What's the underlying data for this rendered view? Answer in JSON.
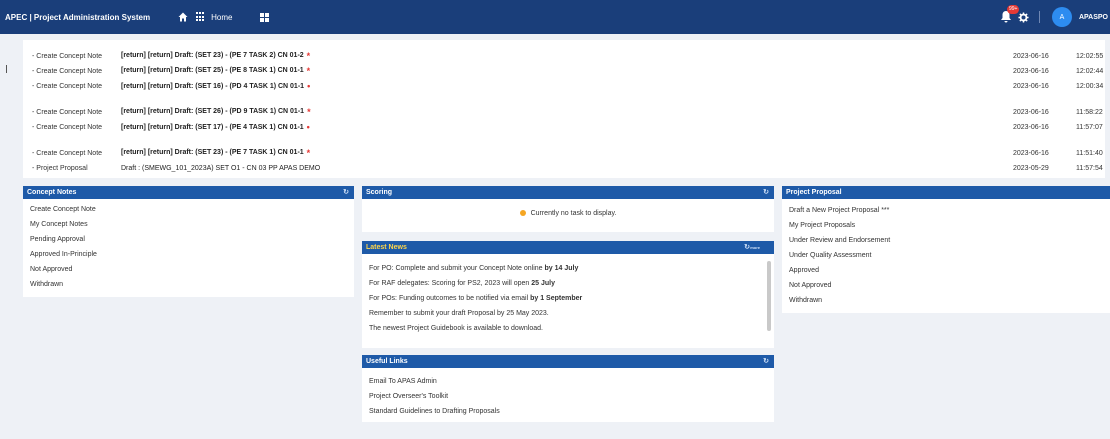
{
  "topbar": {
    "title": "APEC | Project Administration System",
    "home_label": "Home",
    "badge": "99+",
    "avatar_initial": "A",
    "username": "APASPO"
  },
  "activity": [
    {
      "type": "- Create Concept Note",
      "desc": "[return] [return]  Draft:  (SET 23) - (PE 7 TASK 2) CN 01-2",
      "date": "2023-06-16",
      "time": "12:02:55"
    },
    {
      "type": "- Create Concept Note",
      "desc": "[return] [return]  Draft:  (SET 25) - (PE 8 TASK 1) CN 01-1",
      "date": "2023-06-16",
      "time": "12:02:44"
    },
    {
      "type": "- Create Concept Note",
      "desc": "[return] [return]  Draft:  (SET 16) - (PD 4 TASK 1) CN 01-1",
      "date": "2023-06-16",
      "time": "12:00:34"
    },
    {
      "type": "- Create Concept Note",
      "desc": "[return] [return]  Draft:  (SET 26) - (PD 9 TASK 1) CN 01-1",
      "date": "2023-06-16",
      "time": "11:58:22"
    },
    {
      "type": "- Create Concept Note",
      "desc": "[return] [return]  Draft:  (SET 17) - (PE 4 TASK 1) CN 01-1",
      "date": "2023-06-16",
      "time": "11:57:07"
    },
    {
      "type": "- Create Concept Note",
      "desc": "[return] [return]  Draft:  (SET 23) - (PE 7 TASK 1) CN 01-1",
      "date": "2023-06-16",
      "time": "11:51:40"
    },
    {
      "type": "- Project Proposal",
      "desc": "Draft : (SMEWG_101_2023A) SET O1 - CN 03 PP APAS DEMO",
      "date": "2023-05-29",
      "time": "11:57:54"
    }
  ],
  "concept_notes": {
    "title": "Concept Notes",
    "items": [
      "Create Concept Note",
      "My Concept Notes",
      "Pending Approval",
      "Approved In-Principle",
      "Not Approved",
      "Withdrawn"
    ]
  },
  "scoring": {
    "title": "Scoring",
    "empty": "Currently no task to display."
  },
  "news": {
    "title": "Latest News",
    "more": "more",
    "items": [
      {
        "text": "For PO: Complete and submit your Concept Note online ",
        "bold": "by 14 July"
      },
      {
        "text": "For RAF delegates: Scoring for PS2, 2023 will open ",
        "bold": "25 July"
      },
      {
        "text": "For POs: Funding outcomes to be notified via email ",
        "bold": "by 1 September"
      },
      {
        "text": "Remember to submit your draft Proposal by 25 May 2023.",
        "bold": ""
      },
      {
        "text": "The newest Project Guidebook is available to download.",
        "bold": ""
      }
    ]
  },
  "links": {
    "title": "Useful Links",
    "items": [
      "Email To APAS Admin",
      "Project Overseer's Toolkit",
      "Standard Guidelines to Drafting Proposals"
    ]
  },
  "proposal": {
    "title": "Project Proposal",
    "items": [
      "Draft a New Project Proposal ***",
      "My Project Proposals",
      "Under Review and Endorsement",
      "Under Quality Assessment",
      "Approved",
      "Not Approved",
      "Withdrawn"
    ]
  }
}
